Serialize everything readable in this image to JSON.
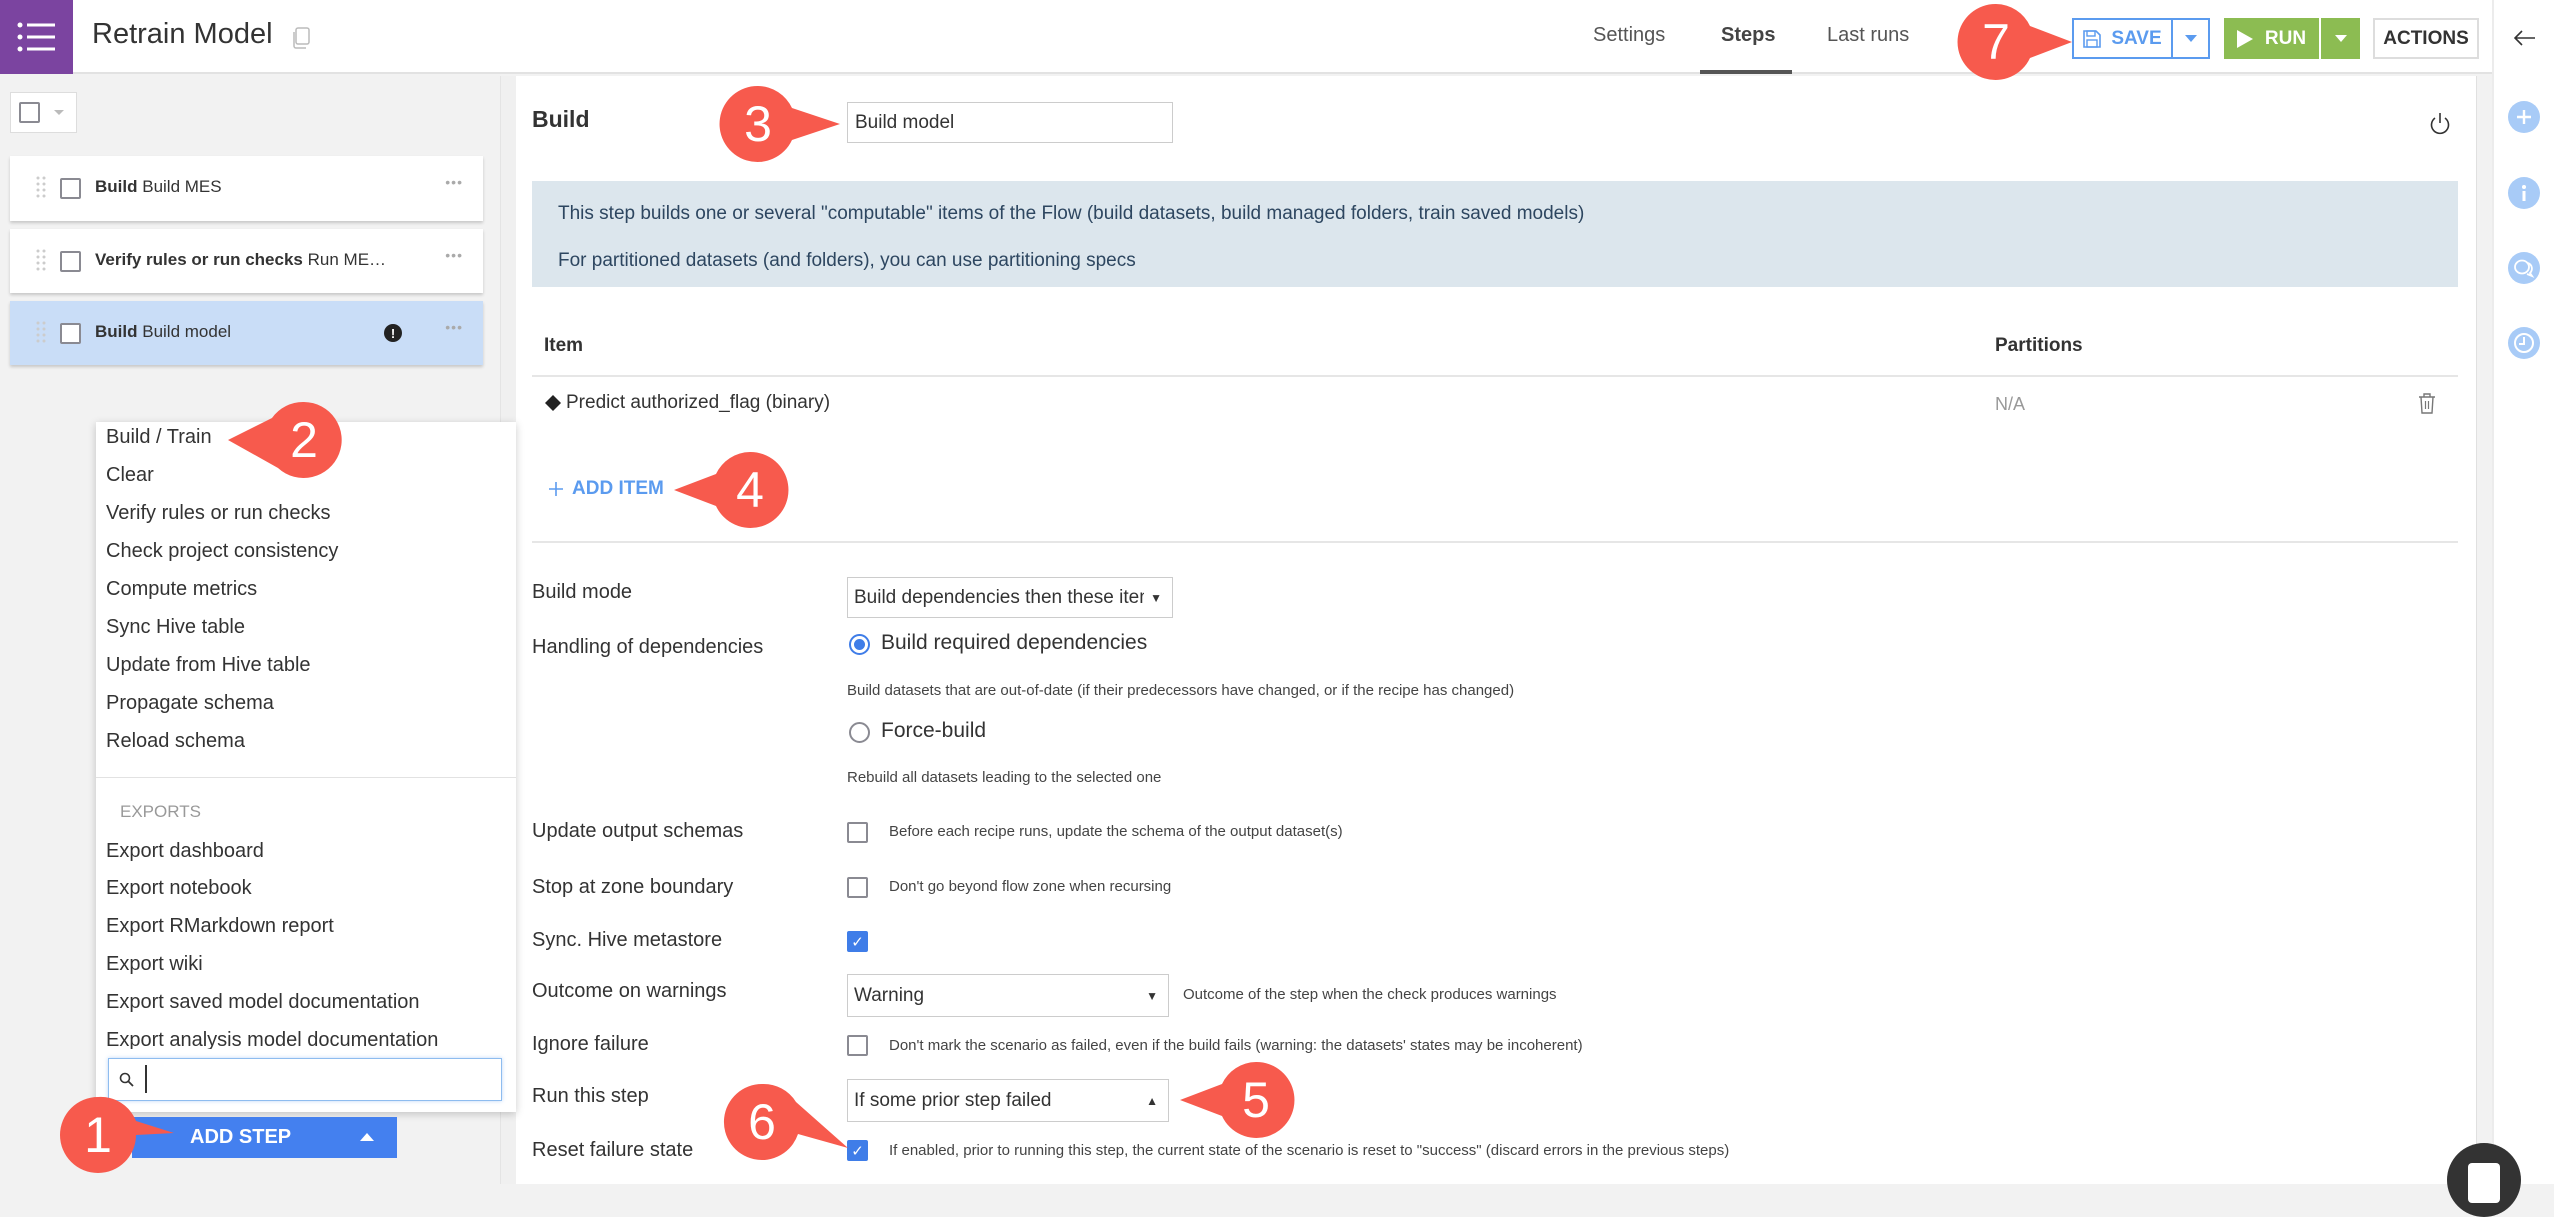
{
  "header": {
    "title": "Retrain Model",
    "tabs": [
      {
        "label": "Settings",
        "active": false
      },
      {
        "label": "Steps",
        "active": true
      },
      {
        "label": "Last runs",
        "active": false
      }
    ],
    "save_label": "SAVE",
    "run_label": "RUN",
    "actions_label": "ACTIONS"
  },
  "steps": [
    {
      "type": "Build",
      "name": "Build MES",
      "selected": false,
      "warning": false
    },
    {
      "type": "Verify rules or run checks",
      "name": "Run ME…",
      "selected": false,
      "warning": false
    },
    {
      "type": "Build",
      "name": "Build model",
      "selected": true,
      "warning": true
    }
  ],
  "step_menu": {
    "items": [
      "Build / Train",
      "Clear",
      "Verify rules or run checks",
      "Check project consistency",
      "Compute metrics",
      "Sync Hive table",
      "Update from Hive table",
      "Propagate schema",
      "Reload schema"
    ],
    "section_label": "EXPORTS",
    "export_items": [
      "Export dashboard",
      "Export notebook",
      "Export RMarkdown report",
      "Export wiki",
      "Export saved model documentation",
      "Export analysis model documentation"
    ],
    "search_value": "",
    "add_step_label": "ADD STEP"
  },
  "step_editor": {
    "type_label": "Build",
    "step_name": "Build model",
    "info_lines": [
      "This step builds one or several \"computable\" items of the Flow (build datasets, build managed folders, train saved models)",
      "For partitioned datasets (and folders), you can use partitioning specs"
    ],
    "table": {
      "columns": [
        "Item",
        "Partitions"
      ],
      "rows": [
        {
          "item": "Predict authorized_flag (binary)",
          "partitions": "N/A"
        }
      ]
    },
    "add_item_label": "ADD ITEM",
    "build_mode": {
      "label": "Build mode",
      "value": "Build dependencies then these items"
    },
    "dependencies": {
      "label": "Handling of dependencies",
      "options": [
        {
          "label": "Build required dependencies",
          "help": "Build datasets that are out-of-date (if their predecessors have changed, or if the recipe has changed)",
          "selected": true
        },
        {
          "label": "Force-build",
          "help": "Rebuild all datasets leading to the selected one",
          "selected": false
        }
      ]
    },
    "update_output_schemas": {
      "label": "Update output schemas",
      "checked": false,
      "help": "Before each recipe runs, update the schema of the output dataset(s)"
    },
    "stop_at_zone_boundary": {
      "label": "Stop at zone boundary",
      "checked": false,
      "help": "Don't go beyond flow zone when recursing"
    },
    "sync_hive": {
      "label": "Sync. Hive metastore",
      "checked": true
    },
    "outcome_on_warnings": {
      "label": "Outcome on warnings",
      "value": "Warning",
      "help": "Outcome of the step when the check produces warnings"
    },
    "ignore_failure": {
      "label": "Ignore failure",
      "checked": false,
      "help": "Don't mark the scenario as failed, even if the build fails (warning: the datasets' states may be incoherent)"
    },
    "run_this_step": {
      "label": "Run this step",
      "value": "If some prior step failed"
    },
    "reset_failure_state": {
      "label": "Reset failure state",
      "checked": true,
      "help": "If enabled, prior to running this step, the current state of the scenario is reset to \"success\" (discard errors in the previous steps)"
    }
  },
  "callouts": [
    "1",
    "2",
    "3",
    "4",
    "5",
    "6",
    "7"
  ],
  "colors": {
    "brand": "#7b44a0",
    "primary": "#4480ef",
    "save": "#5b9bef",
    "run": "#8cbc52",
    "callout": "#f75a4d",
    "info_bg": "#dce6ed",
    "selected_step": "#c9ddf7"
  }
}
